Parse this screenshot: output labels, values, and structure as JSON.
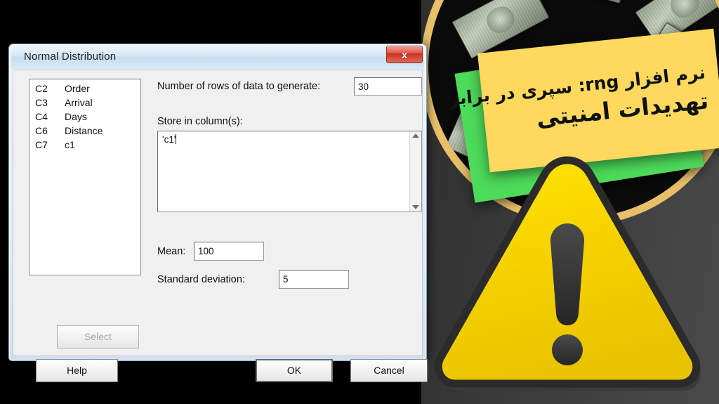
{
  "dialog": {
    "title": "Normal Distribution",
    "close_label": "x",
    "variable_list": [
      {
        "column": "C2",
        "name": "Order"
      },
      {
        "column": "C3",
        "name": "Arrival"
      },
      {
        "column": "C4",
        "name": "Days"
      },
      {
        "column": "C6",
        "name": "Distance"
      },
      {
        "column": "C7",
        "name": "c1"
      }
    ],
    "fields": {
      "rows_label": "Number of rows of data to generate:",
      "rows_value": "30",
      "store_label": "Store in column(s):",
      "store_value": "'c1'",
      "mean_label": "Mean:",
      "mean_value": "100",
      "sd_label": "Standard deviation:",
      "sd_value": "5"
    },
    "buttons": {
      "select": "Select",
      "help": "Help",
      "ok": "OK",
      "cancel": "Cancel"
    }
  },
  "promo": {
    "line1": "نرم افزار rng: سپری در برابر",
    "line2": "تهدیدات امنیتی"
  },
  "colors": {
    "card_yellow": "#ffd95e",
    "card_green": "#4ddb5a",
    "ring_gold": "#e8c06a",
    "warning_yellow": "#f5d400",
    "close_red": "#c8301f"
  }
}
